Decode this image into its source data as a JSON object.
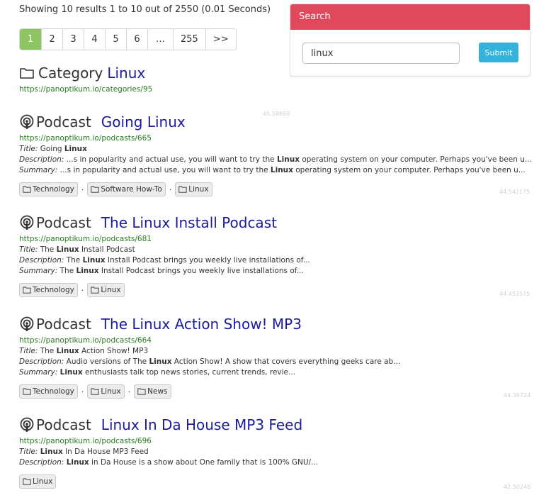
{
  "summary_text": "Showing 10 results 1 to 10 out of 2550 (0.01 Seconds)",
  "pagination": [
    "1",
    "2",
    "3",
    "4",
    "5",
    "6",
    "…",
    "255",
    ">>"
  ],
  "search": {
    "header": "Search",
    "value": "linux",
    "submit_label": "Submit"
  },
  "category": {
    "type": "Category",
    "name": "Linux",
    "url": "https://panoptikum.io/categories/95"
  },
  "results": [
    {
      "type": "Podcast",
      "name": "Going Linux",
      "url": "https://panoptikum.io/podcasts/665",
      "title_label": "Title:",
      "title_parts": [
        "Going ",
        "Linux",
        ""
      ],
      "description_label": "Description:",
      "description_parts": [
        " ...s in popularity and actual use, you will want to try the ",
        "Linux",
        " operating system on your computer. Perhaps you've been u..."
      ],
      "summary_label": "Summary:",
      "summary_parts": [
        " ...s in popularity and actual use, you will want to try the ",
        "Linux",
        " operating system on your computer. Perhaps you've been u..."
      ],
      "tags": [
        "Technology",
        "Software How-To",
        "Linux"
      ],
      "score": "45.58868"
    },
    {
      "type": "Podcast",
      "name": "The Linux Install Podcast",
      "url": "https://panoptikum.io/podcasts/681",
      "title_label": "Title:",
      "title_parts": [
        " The ",
        "Linux",
        " Install Podcast"
      ],
      "description_label": "Description:",
      "description_parts": [
        " The ",
        "Linux",
        " Install Podcast brings you weekly live installations of..."
      ],
      "summary_label": "Summary:",
      "summary_parts": [
        " The ",
        "Linux",
        " Install Podcast brings you weekly live installations of..."
      ],
      "tags": [
        "Technology",
        "Linux"
      ],
      "score": "44.542175"
    },
    {
      "type": "Podcast",
      "name": "The Linux Action Show! MP3",
      "url": "https://panoptikum.io/podcasts/664",
      "title_label": "Title:",
      "title_parts": [
        " The ",
        "Linux",
        " Action Show! MP3"
      ],
      "description_label": "Description:",
      "description_parts": [
        " Audio versions of The ",
        "Linux",
        " Action Show! A show that covers everything geeks care ab..."
      ],
      "summary_label": "Summary:",
      "summary_parts": [
        " ",
        "Linux",
        " enthusiasts talk top news stories, current trends, revie..."
      ],
      "tags": [
        "Technology",
        "Linux",
        "News"
      ],
      "score": "44.453575"
    },
    {
      "type": "Podcast",
      "name": "Linux In Da House MP3 Feed",
      "url": "https://panoptikum.io/podcasts/696",
      "title_label": "Title:",
      "title_parts": [
        " ",
        "Linux",
        " In Da House MP3 Feed"
      ],
      "description_label": "Description:",
      "description_parts": [
        " ",
        "Linux",
        " in Da House is a show about One family that is 100% GNU/..."
      ],
      "tags": [
        "Linux"
      ],
      "score": "44.36724"
    }
  ],
  "last_score": "42.50246",
  "colors": {
    "active_page": "#8cc561",
    "search_header": "#e0485c",
    "submit": "#33b3dc",
    "result_link": "#1b1b9c",
    "url": "#287b1f"
  },
  "icons": {
    "category": "folder-icon",
    "podcast": "podcast-icon",
    "tag": "folder-icon"
  }
}
